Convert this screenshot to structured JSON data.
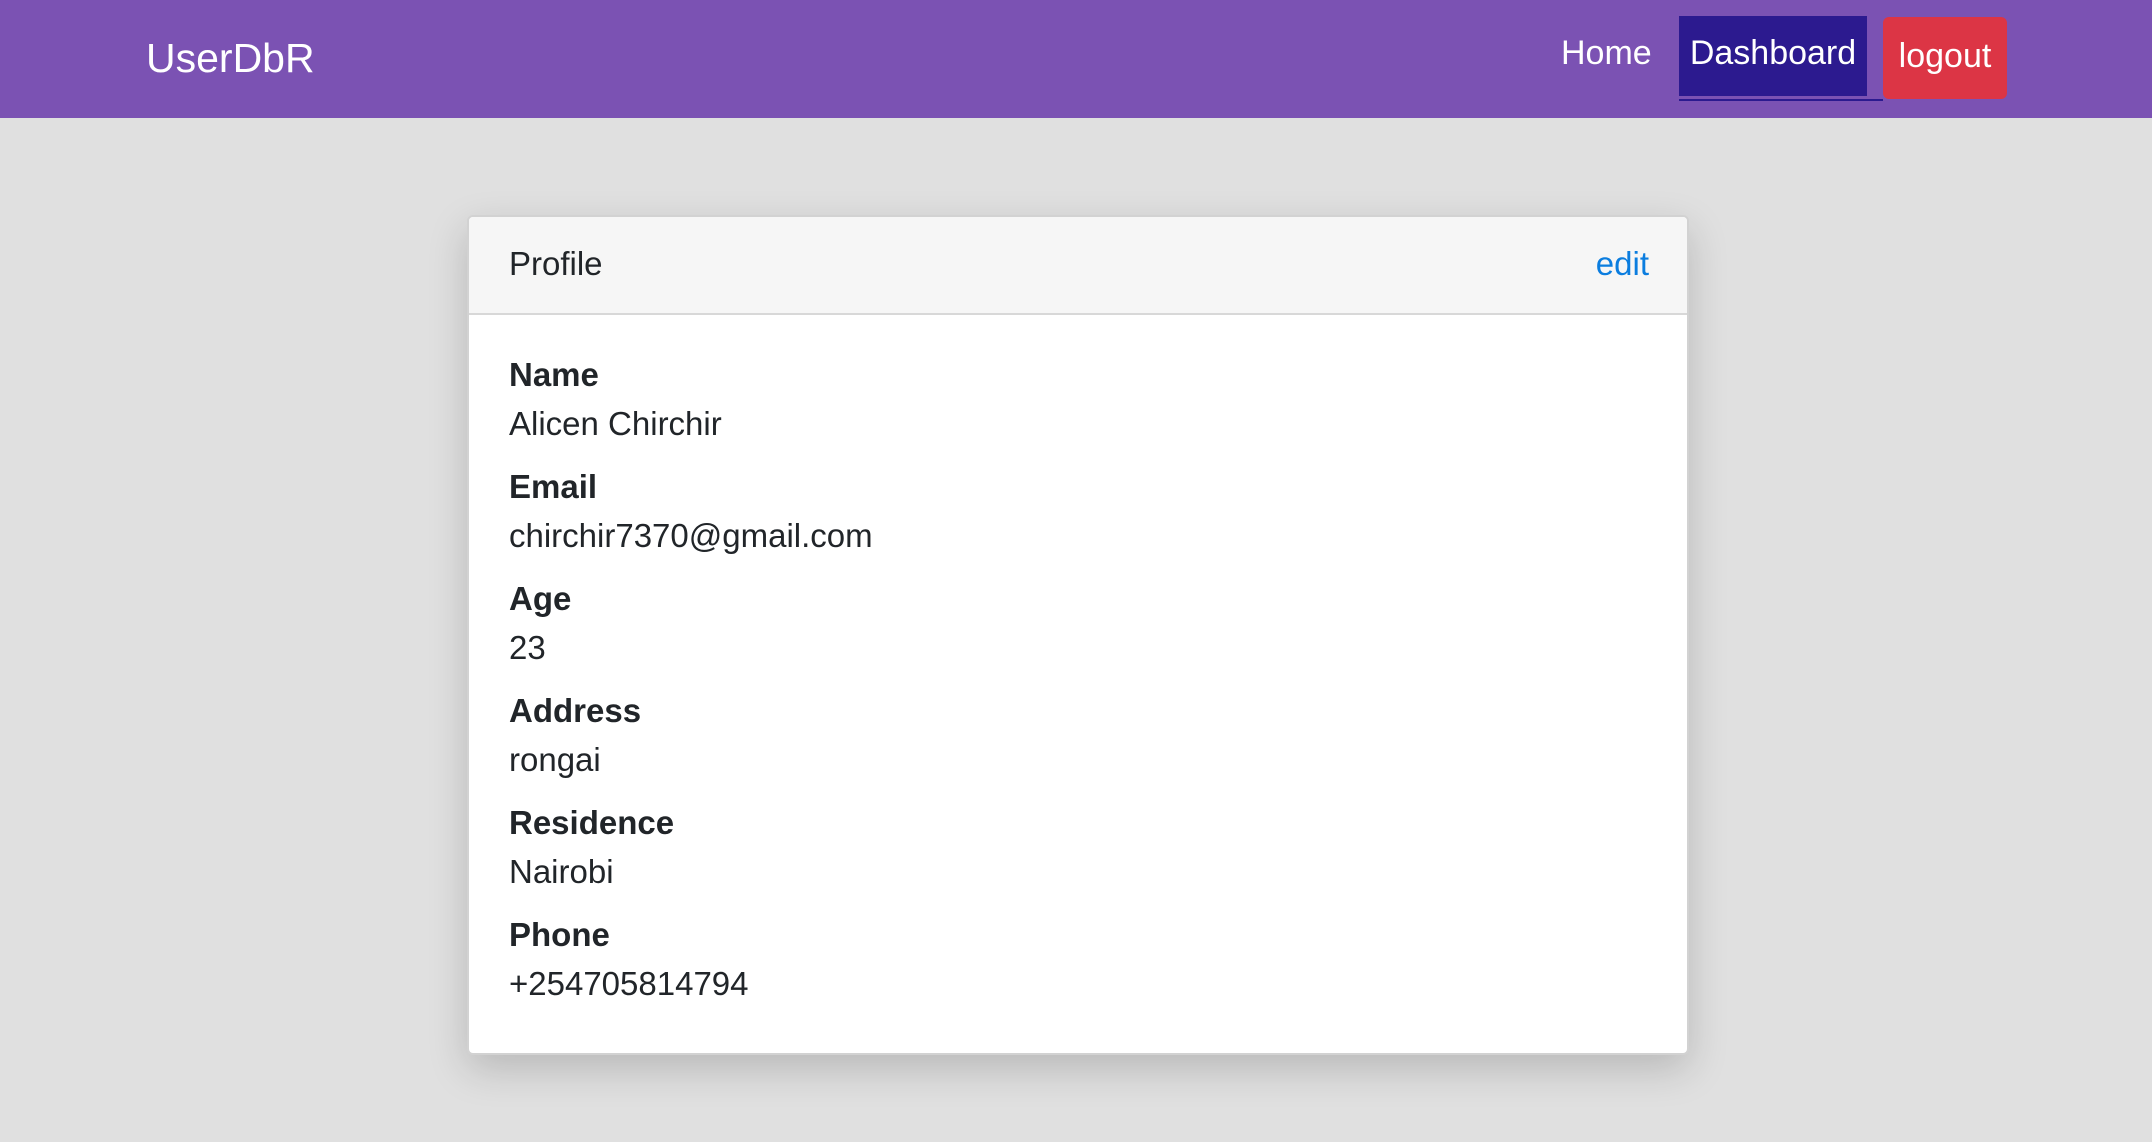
{
  "navbar": {
    "brand": "UserDbR",
    "links": {
      "home": "Home",
      "dashboard": "Dashboard",
      "logout": "logout"
    },
    "colors": {
      "background": "#7b52b3",
      "active": "#2c1a8f",
      "logout": "#dc3545"
    }
  },
  "profile": {
    "title": "Profile",
    "edit_label": "edit",
    "fields": [
      {
        "label": "Name",
        "value": "Alicen Chirchir"
      },
      {
        "label": "Email",
        "value": "chirchir7370@gmail.com"
      },
      {
        "label": "Age",
        "value": "23"
      },
      {
        "label": "Address",
        "value": "rongai"
      },
      {
        "label": "Residence",
        "value": "Nairobi"
      },
      {
        "label": "Phone",
        "value": "+254705814794"
      }
    ]
  }
}
